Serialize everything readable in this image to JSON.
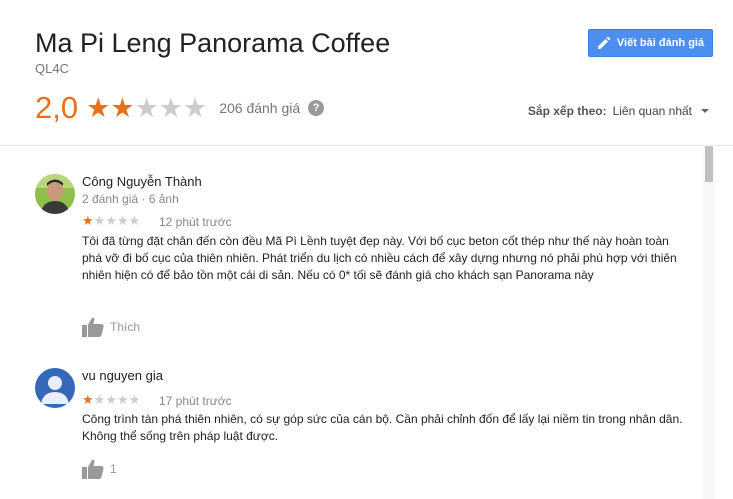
{
  "place": {
    "title": "Ma Pi Leng Panorama Coffee",
    "subtitle": "QL4C"
  },
  "actions": {
    "write_review_label": "Viết bài đánh giá"
  },
  "summary": {
    "rating": "2,0",
    "stars_filled": 2,
    "stars_total": 5,
    "review_count": "206 đánh giá",
    "help_glyph": "?"
  },
  "sort": {
    "label": "Sắp xếp theo:",
    "value": "Liên quan nhất"
  },
  "reviews": [
    {
      "name": "Công Nguyễn Thành",
      "meta": "2 đánh giá · 6 ảnh",
      "stars": 1,
      "time": "12 phút trước",
      "text": "Tôi đã từng đặt chân đến còn đều Mã Pì Lềnh tuyệt đẹp này. Với bố cục beton cốt thép như thế này hoàn toàn phá vỡ đi bố cục của thiên nhiên. Phát triển du lịch có nhiều cách để xây dựng nhưng nó phải phù hợp với thiên nhiên hiện có để bảo tồn một cái di sản. Nếu có 0* tối sẽ đánh giá cho khách sạn Panorama này",
      "like_label": "Thích"
    },
    {
      "name": "vu nguyen gia",
      "meta": "",
      "stars": 1,
      "time": "17 phút trước",
      "text": "Công trình tàn phá thiên nhiên, có sự góp sức của cán bộ. Cần phải chỉnh đốn để lấy lại niềm tin trong nhân dân. Không thể sống trên pháp luật được.",
      "like_label": "1"
    }
  ],
  "colors": {
    "accent": "#e7711b",
    "button": "#4d8ff0"
  },
  "icons": [
    "pencil-icon",
    "help-icon",
    "caret-down-icon",
    "thumbs-up-icon",
    "avatar-photo",
    "avatar-placeholder"
  ]
}
